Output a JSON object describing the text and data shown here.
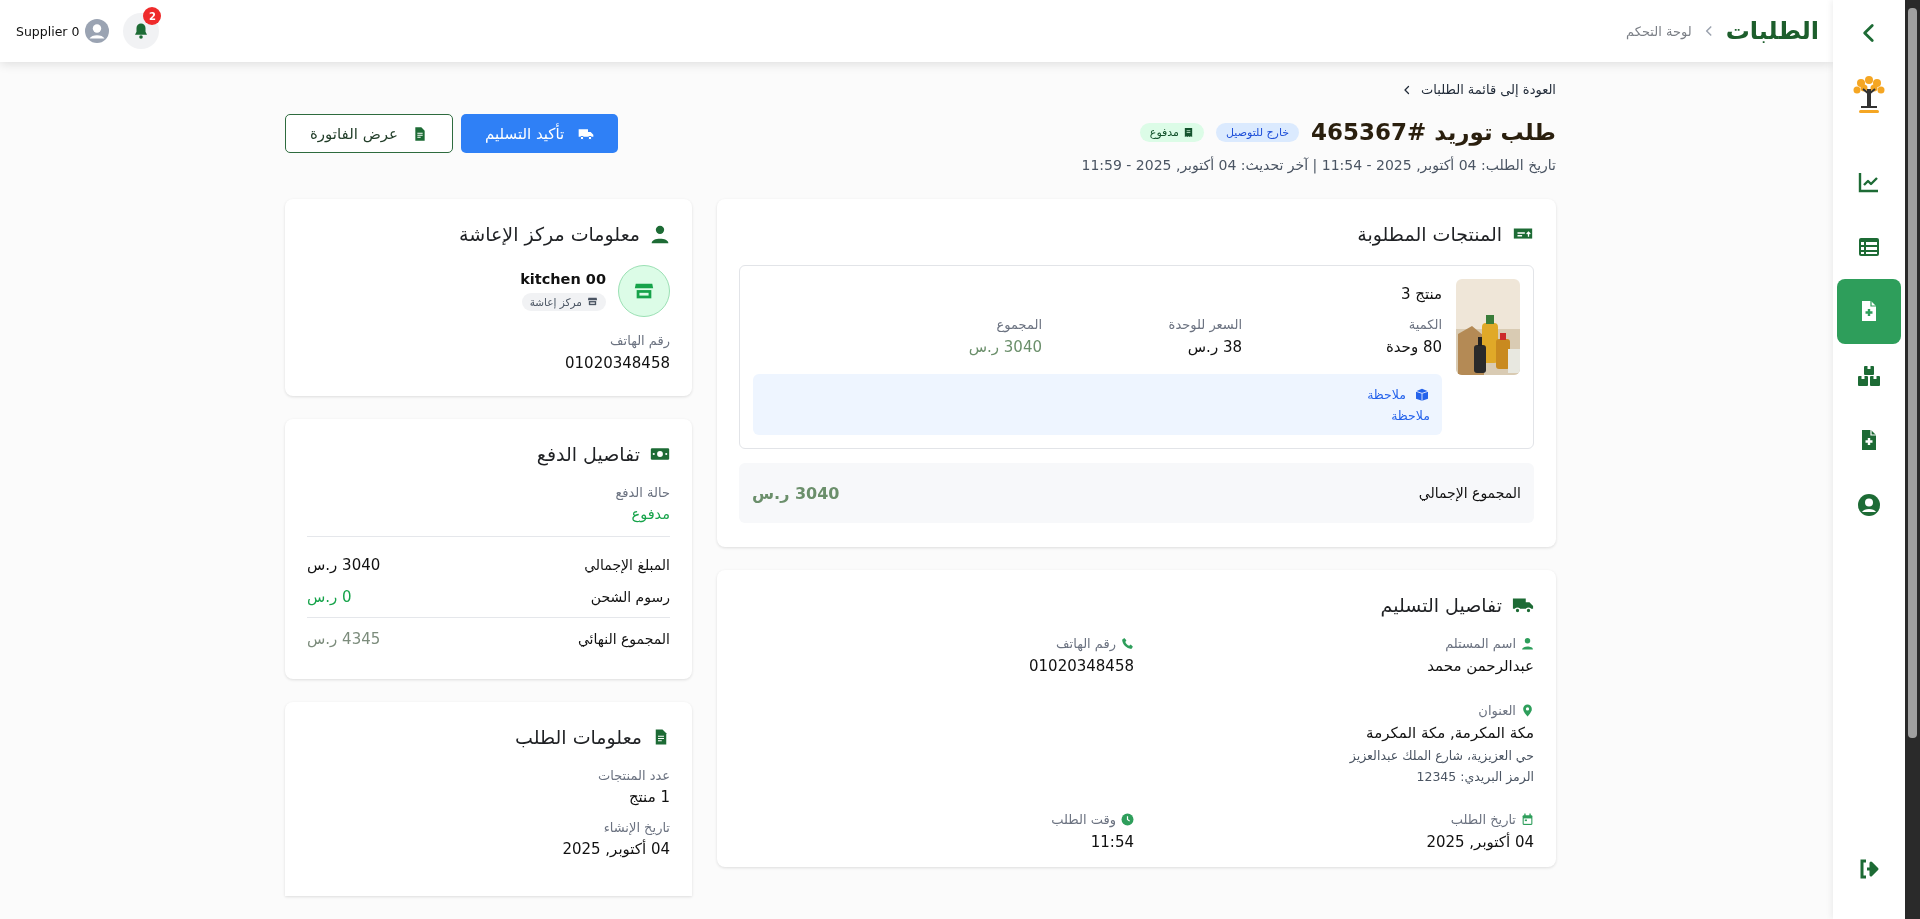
{
  "topbar": {
    "title": "الطلبات",
    "breadcrumb": "لوحة التحكم",
    "notifications": "2",
    "user": "Supplier 0"
  },
  "sidebar": {
    "items": [
      {
        "kind": "chart",
        "selected": false
      },
      {
        "kind": "table",
        "selected": false
      },
      {
        "kind": "file-plus",
        "selected": true
      },
      {
        "kind": "boxes",
        "selected": false
      },
      {
        "kind": "file-plus",
        "selected": false
      },
      {
        "kind": "user",
        "selected": false
      }
    ]
  },
  "back_link": "العودة إلى قائمة الطلبات",
  "order": {
    "title": "طلب توريد #465367",
    "badges": [
      {
        "label": "خارج للتوصيل",
        "kind": "delivery"
      },
      {
        "label": "مدفوع",
        "kind": "paid"
      }
    ],
    "dates": "تاريخ الطلب: 04 أكتوبر, 2025 - 11:54 | آخر تحديث: 04 أكتوبر, 2025 - 11:59"
  },
  "actions": [
    {
      "label": "تأكيد التسليم",
      "kind": "primary"
    },
    {
      "label": "عرض الفاتورة",
      "kind": "outline"
    }
  ],
  "products_card": {
    "title": "المنتجات المطلوبة",
    "items": [
      {
        "name": "منتج 3",
        "fields": [
          {
            "label": "الكمية",
            "value": "80 وحدة",
            "kind": "plain"
          },
          {
            "label": "السعر للوحدة",
            "value": "38 ر.س",
            "kind": "plain"
          },
          {
            "label": "المجموع",
            "value": "3040 ر.س",
            "kind": "total"
          }
        ],
        "note_title": "ملاحظة",
        "note": "ملاحظة"
      }
    ],
    "total_label": "المجموع الإجمالي",
    "total_value": "3040 ر.س"
  },
  "delivery_card": {
    "title": "تفاصيل التسليم",
    "fields": [
      {
        "kind": "person",
        "label": "اسم المستلم",
        "value": "عبدالرحمن محمد"
      },
      {
        "kind": "phone",
        "label": "رقم الهاتف",
        "value": "01020348458"
      },
      {
        "kind": "location",
        "label": "العنوان",
        "value": "مكة المكرمة, مكة المكرمة",
        "details": [
          "حي العزيزية، شارع الملك عبدالعزيز",
          "الرمز البريدي: 12345"
        ]
      },
      {
        "kind": "calendar",
        "label": "تاريخ الطلب",
        "value": "04 أكتوبر, 2025"
      },
      {
        "kind": "clock",
        "label": "وقت الطلب",
        "value": "11:54"
      }
    ]
  },
  "center_card": {
    "title": "معلومات مركز الإعاشة",
    "name": "kitchen 00",
    "tag": "مركز إعاشة",
    "phone_label": "رقم الهاتف",
    "phone": "01020348458"
  },
  "payment_card": {
    "title": "تفاصيل الدفع",
    "status_label": "حالة الدفع",
    "status": "مدفوع",
    "rows": [
      {
        "label": "المبلغ الإجمالي",
        "value": "3040 ر.س",
        "kind": "amount"
      },
      {
        "label": "رسوم الشحن",
        "value": "0 ر.س",
        "kind": "shipping"
      },
      {
        "label": "المجموع النهائي",
        "value": "4345 ر.س",
        "kind": "final"
      }
    ]
  },
  "order_info_card": {
    "title": "معلومات الطلب",
    "fields": [
      {
        "label": "عدد المنتجات",
        "value": "1 منتج"
      },
      {
        "label": "تاريخ الإنشاء",
        "value": "04 أكتوبر, 2025"
      }
    ]
  }
}
